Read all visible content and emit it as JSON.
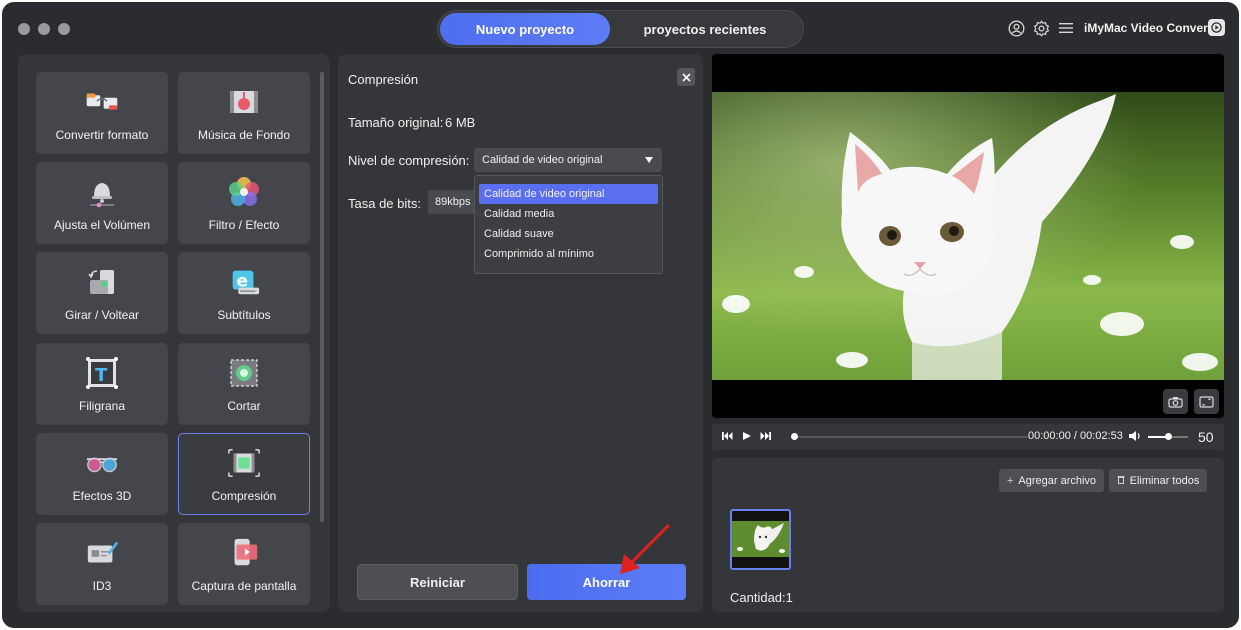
{
  "titlebar": {
    "tabs": [
      {
        "label": "Nuevo proyecto",
        "active": true
      },
      {
        "label": "proyectos recientes",
        "active": false
      }
    ],
    "app_name": "iMyMac Video Converter",
    "icons": [
      "user-icon",
      "gear-icon",
      "menu-icon",
      "app-logo-icon"
    ]
  },
  "tools": [
    {
      "label": "Convertir formato",
      "icon": "convert-format-icon"
    },
    {
      "label": "Música de Fondo",
      "icon": "background-music-icon"
    },
    {
      "label": "Ajusta el Volúmen",
      "icon": "volume-icon"
    },
    {
      "label": "Filtro / Efecto",
      "icon": "filter-icon"
    },
    {
      "label": "Girar / Voltear",
      "icon": "rotate-icon"
    },
    {
      "label": "Subtítulos",
      "icon": "subtitles-icon"
    },
    {
      "label": "Filigrana",
      "icon": "watermark-icon"
    },
    {
      "label": "Cortar",
      "icon": "crop-icon"
    },
    {
      "label": "Efectos 3D",
      "icon": "3d-glasses-icon"
    },
    {
      "label": "Compresión",
      "icon": "compression-icon",
      "selected": true
    },
    {
      "label": "ID3",
      "icon": "id3-icon"
    },
    {
      "label": "Captura de pantalla",
      "icon": "screen-capture-icon"
    }
  ],
  "compression": {
    "title": "Compresión",
    "original_size_label": "Tamaño original:",
    "original_size_value": "6 MB",
    "level_label": "Nivel de compresión:",
    "level_selected": "Calidad de video original",
    "level_options": [
      "Calidad de video original",
      "Calidad media",
      "Calidad suave",
      "Comprimido al mínimo"
    ],
    "bitrate_label": "Tasa de bits:",
    "bitrate_value": "89kbps",
    "reset_label": "Reiniciar",
    "save_label": "Ahorrar"
  },
  "player": {
    "time": "00:00:00 / 00:02:53",
    "volume": "50",
    "progress": 0,
    "volume_fraction": 0.5
  },
  "files": {
    "add_label": "Agregar archivo",
    "remove_label": "Eliminar todos",
    "quantity": "Cantidad:1"
  },
  "colors": {
    "accent": "#5a72f2",
    "window_bg": "#2b2c2f",
    "panel_bg": "#35363a",
    "arrow": "#e0221e"
  }
}
